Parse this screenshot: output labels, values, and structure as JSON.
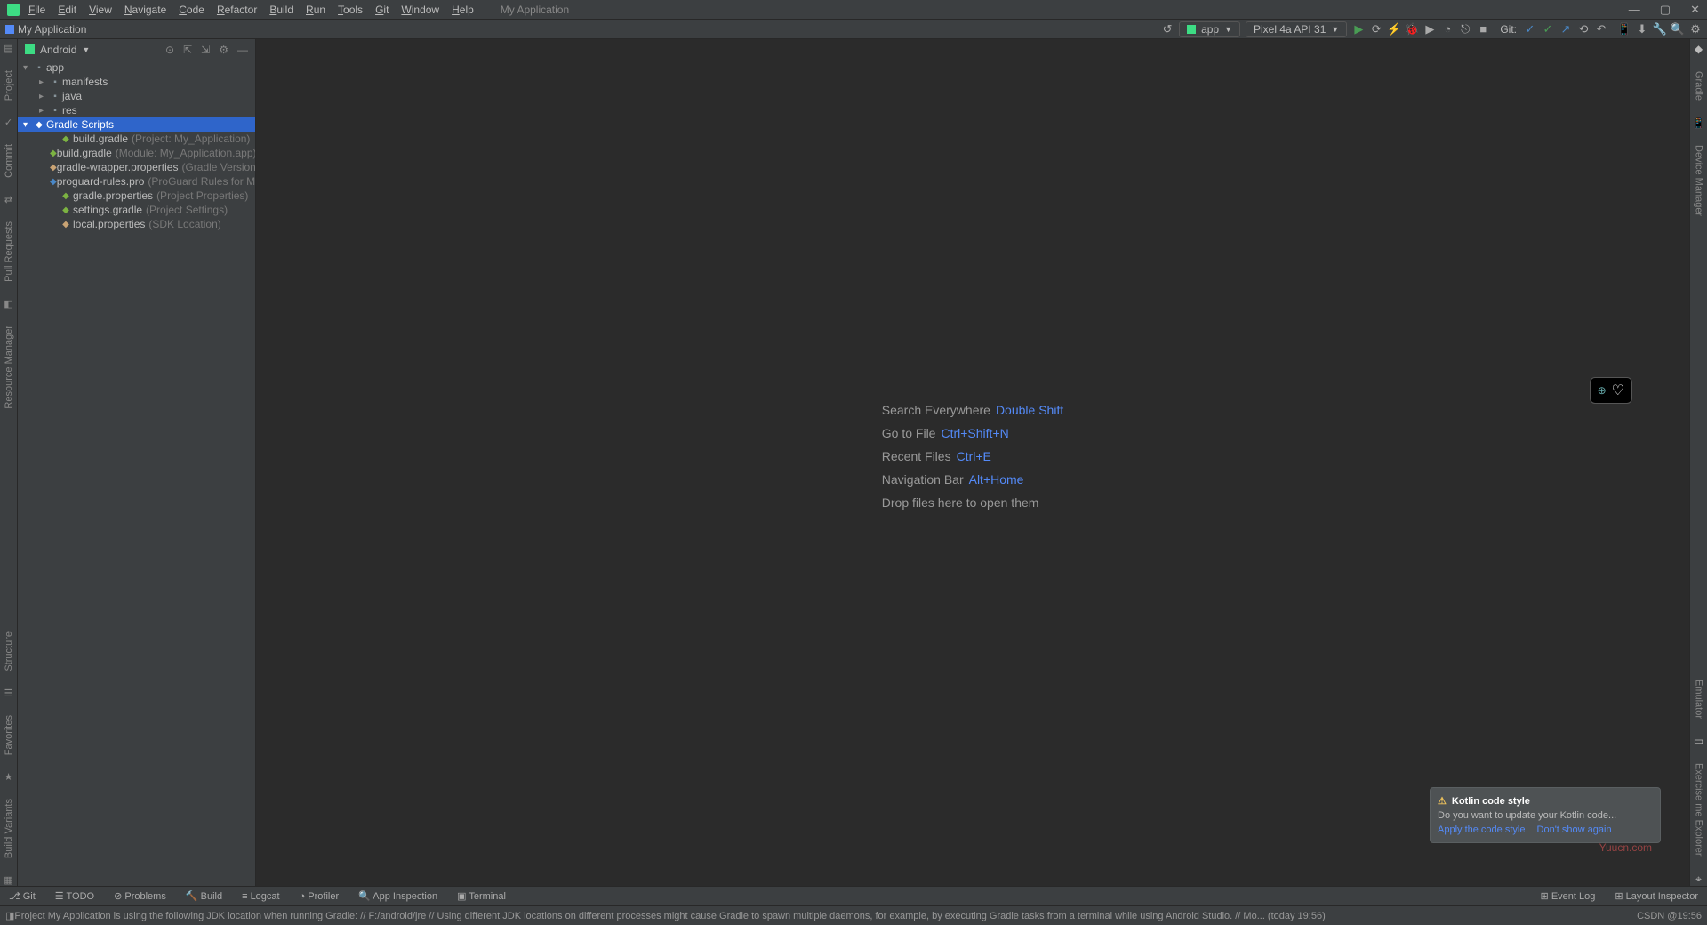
{
  "title": {
    "app": "My Application"
  },
  "menu": [
    "File",
    "Edit",
    "View",
    "Navigate",
    "Code",
    "Refactor",
    "Build",
    "Run",
    "Tools",
    "Git",
    "Window",
    "Help"
  ],
  "breadcrumb": "My Application",
  "config": {
    "app": "app",
    "device": "Pixel 4a API 31"
  },
  "git_label": "Git:",
  "panel": {
    "title": "Android"
  },
  "tree": {
    "root": "app",
    "dirs": [
      "manifests",
      "java",
      "res"
    ],
    "scripts_label": "Gradle Scripts",
    "scripts": [
      {
        "name": "build.gradle",
        "hint": "(Project: My_Application)",
        "t": "g"
      },
      {
        "name": "build.gradle",
        "hint": "(Module: My_Application.app)",
        "t": "g"
      },
      {
        "name": "gradle-wrapper.properties",
        "hint": "(Gradle Version)",
        "t": "p"
      },
      {
        "name": "proguard-rules.pro",
        "hint": "(ProGuard Rules for My_App",
        "t": "l"
      },
      {
        "name": "gradle.properties",
        "hint": "(Project Properties)",
        "t": "g"
      },
      {
        "name": "settings.gradle",
        "hint": "(Project Settings)",
        "t": "g"
      },
      {
        "name": "local.properties",
        "hint": "(SDK Location)",
        "t": "p"
      }
    ]
  },
  "hints": [
    {
      "label": "Search Everywhere",
      "kb": "Double Shift"
    },
    {
      "label": "Go to File",
      "kb": "Ctrl+Shift+N"
    },
    {
      "label": "Recent Files",
      "kb": "Ctrl+E"
    },
    {
      "label": "Navigation Bar",
      "kb": "Alt+Home"
    },
    {
      "label": "Drop files here to open them",
      "kb": ""
    }
  ],
  "notification": {
    "title": "Kotlin code style",
    "body": "Do you want to update your Kotlin code...",
    "a1": "Apply the code style",
    "a2": "Don't show again"
  },
  "left_tools_top": [
    "Commit",
    "Project"
  ],
  "left_tools_bottom": [
    "Build Variants",
    "Favorites",
    "Structure",
    "Resource Manager",
    "Pull Requests"
  ],
  "right_tools": [
    "Gradle",
    "Device Manager",
    "Emulator",
    "Exercise me Explorer"
  ],
  "bottom_tools": [
    "Git",
    "TODO",
    "Problems",
    "Build",
    "Logcat",
    "Profiler",
    "App Inspection",
    "Terminal"
  ],
  "bottom_right": [
    "Event Log",
    "Layout Inspector"
  ],
  "status": {
    "msg": "Project My Application is using the following JDK location when running Gradle: // F:/android/jre // Using different JDK locations on different processes might cause Gradle to spawn multiple daemons, for example, by executing Gradle tasks from a terminal while using Android Studio. // Mo... (today 19:56)",
    "right": "CSDN @19:56"
  },
  "watermark": "Yuucn.com"
}
